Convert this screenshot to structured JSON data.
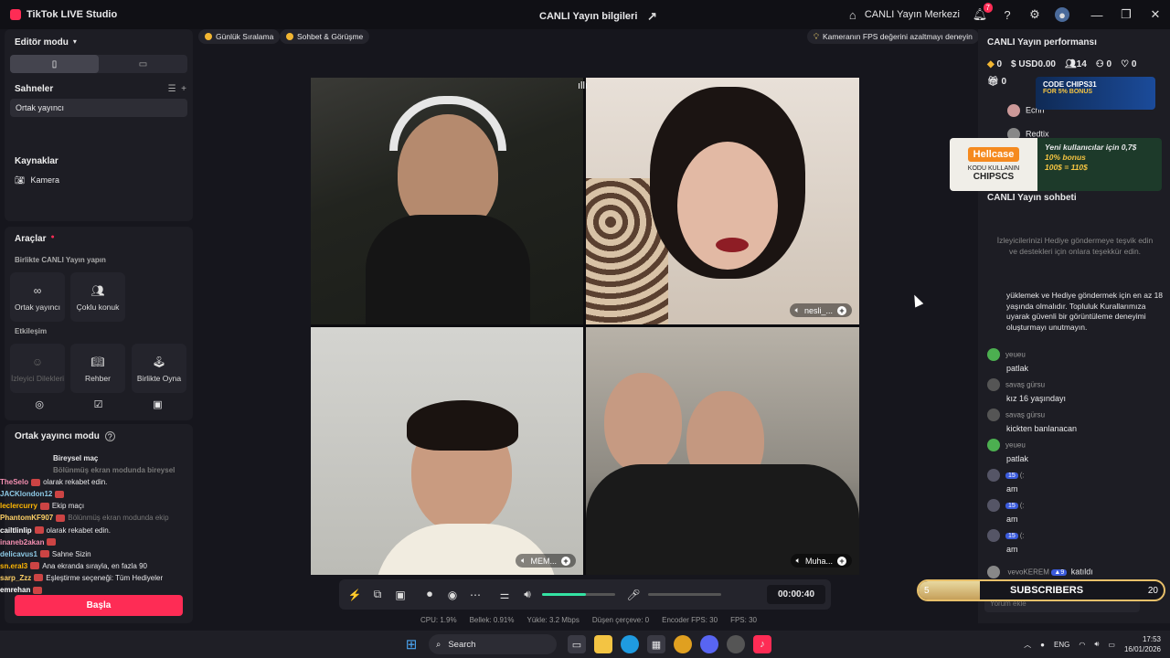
{
  "app": {
    "title": "TikTok LIVE Studio",
    "center_title": "CANLI Yayın bilgileri",
    "live_center": "CANLI Yayın Merkezi",
    "notif_count": "7"
  },
  "left": {
    "editor_mode": "Editör modu",
    "scenes_title": "Sahneler",
    "scene_item": "Ortak yayıncı",
    "sources_title": "Kaynaklar",
    "source_camera": "Kamera",
    "tools_title": "Araçlar",
    "together_title": "Birlikte CANLI Yayın yapın",
    "tool_cohost": "Ortak yayıncı",
    "tool_multiguest": "Çoklu konuk",
    "interaction_title": "Etkileşim",
    "tool_requests": "İzleyici Dilekleri",
    "tool_guide": "Rehber",
    "tool_play": "Birlikte Oyna",
    "cohost_mode": "Ortak yayıncı modu",
    "start": "Başla"
  },
  "overlay_chat": [
    {
      "user": "",
      "text": "Bireysel maç"
    },
    {
      "user": "",
      "text": "Bölünmüş ekran modunda bireysel",
      "dim": true
    },
    {
      "user": "TheSelo",
      "text": "olarak rekabet edin."
    },
    {
      "user": "JACKlondon12",
      "text": ""
    },
    {
      "user": "leclercurry",
      "text": "Ekip maçı"
    },
    {
      "user": "PhantomKF907",
      "text": "Bölünmüş ekran modunda ekip",
      "dim": true
    },
    {
      "user": "cailtlinlip",
      "text": "olarak rekabet edin."
    },
    {
      "user": "inaneb2akan",
      "text": ""
    },
    {
      "user": "delicavus1",
      "text": "Sahne Sizin"
    },
    {
      "user": "sn.eral3",
      "text": "Ana ekranda sırayla, en fazla 90"
    },
    {
      "user": "sarp_Zzz",
      "text": "Eşleştirme seçeneği: Tüm Hediyeler"
    },
    {
      "user": "emrehan",
      "text": ""
    }
  ],
  "chips": {
    "ranking": "Günlük Sıralama",
    "chat_meet": "Sohbet & Görüşme",
    "fps_tip": "Kameranın FPS değerini azaltmayı deneyin"
  },
  "tiles": {
    "t2_label": "nesli_...",
    "t3_label": "MEM...",
    "t4_label": "Muha..."
  },
  "controls": {
    "timer": "00:00:40",
    "volume_level": 0.6
  },
  "stats": {
    "cpu": "CPU: 1.9%",
    "mem": "Bellek: 0.91%",
    "upload": "Yükle: 3.2 Mbps",
    "drop": "Düşen çerçeve: 0",
    "encoder": "Encoder FPS: 30",
    "fps": "FPS: 30"
  },
  "right": {
    "perf_title": "CANLI Yayın performansı",
    "m_diamonds": "0",
    "m_usd": "USD0.00",
    "m_viewers": "14",
    "m_follow": "0",
    "m_likes": "0",
    "m_gifts": "0",
    "top_users": [
      "Ecrin",
      "Redtix"
    ],
    "chat_title": "CANLI Yayın sohbeti",
    "chat_hint": "İzleyicilerinizi Hediye göndermeye teşvik edin ve destekleri için onlara teşekkür edin.",
    "rules_text": "yüklemek ve Hediye göndermek için en az 18 yaşında olmalıdır. Topluluk Kurallarımıza uyarak güvenli bir görüntüleme deneyimi oluşturmayı unutmayın.",
    "messages": [
      {
        "name": "yeueu",
        "text": "patlak"
      },
      {
        "name": "savaş gürsu",
        "text": "kız 16 yaşındayı"
      },
      {
        "name": "savaş gürsu",
        "text": "kickten banlanacan"
      },
      {
        "name": "yeueu",
        "text": "patlak"
      },
      {
        "name": "(:",
        "text": "am",
        "lvl": "15"
      },
      {
        "name": "(:",
        "text": "am",
        "lvl": "15"
      },
      {
        "name": "(:",
        "text": "am",
        "lvl": "15"
      }
    ],
    "last_user": "vevoKEREM",
    "last_text": "katıldı",
    "comment_placeholder": "Yorum ekle"
  },
  "ads": {
    "code_ad": "CODE CHIPS31",
    "code_ad_sub": "FOR 5% BONUS",
    "hellcase": "Hellcase",
    "hellcase_code_label": "KODU KULLANIN",
    "hellcase_code": "CHIPSCS",
    "hellcase_offer1": "Yeni kullanıcılar için 0,7$",
    "hellcase_offer2": "10% bonus",
    "hellcase_offer3": "100$ = 110$"
  },
  "subs": {
    "label": "SUBSCRIBERS",
    "current": "5",
    "goal": "20",
    "progress": 0.25
  },
  "taskbar": {
    "search": "Search",
    "lang": "ENG",
    "time": "17:53",
    "date": "16/01/2026"
  },
  "colors": {
    "accent": "#fe2c55",
    "volume": "#34e3a3"
  }
}
